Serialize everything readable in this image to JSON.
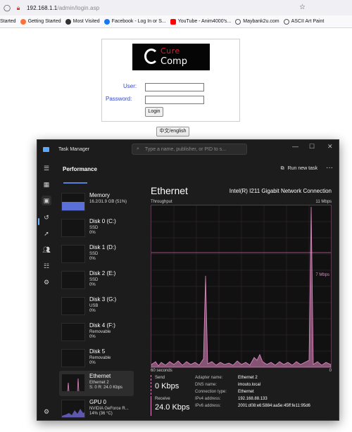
{
  "browser": {
    "url_host": "192.168.1.1",
    "url_path": "/admin/login.asp",
    "bookmarks": [
      {
        "label": "Started",
        "color": ""
      },
      {
        "label": "Getting Started",
        "color": "#ff7139"
      },
      {
        "label": "Most Visited",
        "color": "#333333"
      },
      {
        "label": "Facebook - Log In or S...",
        "color": "#1877f2"
      },
      {
        "label": "YouTube - Anim4000's...",
        "color": "#ff0000"
      },
      {
        "label": "Maybank2u.com",
        "color": "#555555"
      },
      {
        "label": "ASCII Art Paint",
        "color": "#555555"
      }
    ]
  },
  "login": {
    "logo_top": "Cure",
    "logo_bottom": "Comp",
    "user_label": "User:",
    "password_label": "Password:",
    "login_button": "Login",
    "lang_button": "中文/english"
  },
  "taskmanager": {
    "title": "Task Manager",
    "search_placeholder": "Type a name, publisher, or PID to s...",
    "section": "Performance",
    "run_new_task": "Run new task",
    "items": [
      {
        "name": "Memory",
        "l1": "16.2/31.9 GB (51%)",
        "l2": ""
      },
      {
        "name": "Disk 0 (C:)",
        "l1": "SSD",
        "l2": "0%"
      },
      {
        "name": "Disk 1 (D:)",
        "l1": "SSD",
        "l2": "0%"
      },
      {
        "name": "Disk 2 (E:)",
        "l1": "SSD",
        "l2": "0%"
      },
      {
        "name": "Disk 3 (G:)",
        "l1": "USB",
        "l2": "0%"
      },
      {
        "name": "Disk 4 (F:)",
        "l1": "Removable",
        "l2": "0%"
      },
      {
        "name": "Disk 5",
        "l1": "Removable",
        "l2": "0%"
      },
      {
        "name": "Ethernet",
        "l1": "Ethernet 2",
        "l2": "S: 0 R: 24.0 Kbps"
      },
      {
        "name": "GPU 0",
        "l1": "NVIDIA GeForce R...",
        "l2": "14% (36 °C)"
      }
    ],
    "main": {
      "heading": "Ethernet",
      "adapter": "Intel(R) I211 Gigabit Network Connection",
      "throughput_label": "Throughput",
      "max_label": "11 Mbps",
      "ref_label": "7 Mbps",
      "x_left": "60 seconds",
      "x_right": "0",
      "send_label": "Send",
      "send_value": "0 Kbps",
      "receive_label": "Receive",
      "receive_value": "24.0 Kbps",
      "details": [
        {
          "k": "Adapter name:",
          "v": "Ethernet 2"
        },
        {
          "k": "DNS name:",
          "v": "imouto.local"
        },
        {
          "k": "Connection type:",
          "v": "Ethernet"
        },
        {
          "k": "IPv4 address:",
          "v": "192.168.88.133"
        },
        {
          "k": "IPv6 address:",
          "v": "2001:d08:e6:5884:aa5e:45ff:fe11:95d6"
        }
      ]
    }
  }
}
